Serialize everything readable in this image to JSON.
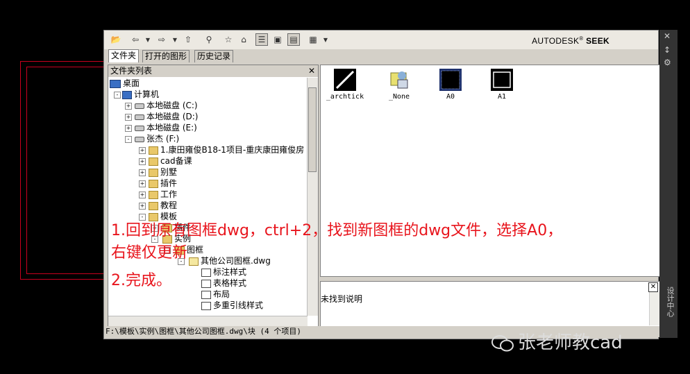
{
  "toolbar": {
    "brand_prefix": "AUTODESK",
    "brand_reg": "®",
    "brand_suffix": "SEEK"
  },
  "tabs": [
    "文件夹",
    "打开的图形",
    "历史记录"
  ],
  "tree_header": "文件夹列表",
  "tree": [
    {
      "label": "桌面",
      "icon": "desktop-icon"
    },
    {
      "label": "计算机",
      "icon": "computer-icon"
    },
    {
      "label": "本地磁盘 (C:)",
      "icon": "drive-icon"
    },
    {
      "label": "本地磁盘 (D:)",
      "icon": "drive-icon"
    },
    {
      "label": "本地磁盘 (E:)",
      "icon": "drive-icon"
    },
    {
      "label": "张杰 (F:)",
      "icon": "drive-icon"
    },
    {
      "label": "1.康田雍俊B18-1项目-重庆康田雍俊房",
      "icon": "folder-icon"
    },
    {
      "label": "cad备课",
      "icon": "folder-icon"
    },
    {
      "label": "别墅",
      "icon": "folder-icon"
    },
    {
      "label": "插件",
      "icon": "folder-icon"
    },
    {
      "label": "工作",
      "icon": "folder-icon"
    },
    {
      "label": "教程",
      "icon": "folder-icon"
    },
    {
      "label": "模板",
      "icon": "folder-icon"
    },
    {
      "label": "插件",
      "icon": "folder-icon"
    },
    {
      "label": "实例",
      "icon": "folder-icon"
    },
    {
      "label": "图框",
      "icon": "folder-icon"
    },
    {
      "label": "其他公司图框.dwg",
      "icon": "dwg-file-icon"
    },
    {
      "label": "标注样式",
      "icon": "dimstyle-icon"
    },
    {
      "label": "表格样式",
      "icon": "tablestyle-icon"
    },
    {
      "label": "布局",
      "icon": "layout-icon"
    },
    {
      "label": "多重引线样式",
      "icon": "mleader-icon"
    }
  ],
  "blocks": [
    "_archtick",
    "_None",
    "A0",
    "A1"
  ],
  "description": "未找到说明",
  "status": "F:\\模板\\实例\\图框\\其他公司图框.dwg\\块 (4 个项目)",
  "side_title": "设计中心",
  "overlay": {
    "line1": "1.回到原有图框dwg，ctrl+2，找到新图框的dwg文件，选择A0，",
    "line2": "右键仅更新",
    "line3": "2.完成。"
  },
  "watermark": "张老师教cad",
  "colors": {
    "annotation": "#e8141c",
    "cad_frame": "#c8001e"
  }
}
